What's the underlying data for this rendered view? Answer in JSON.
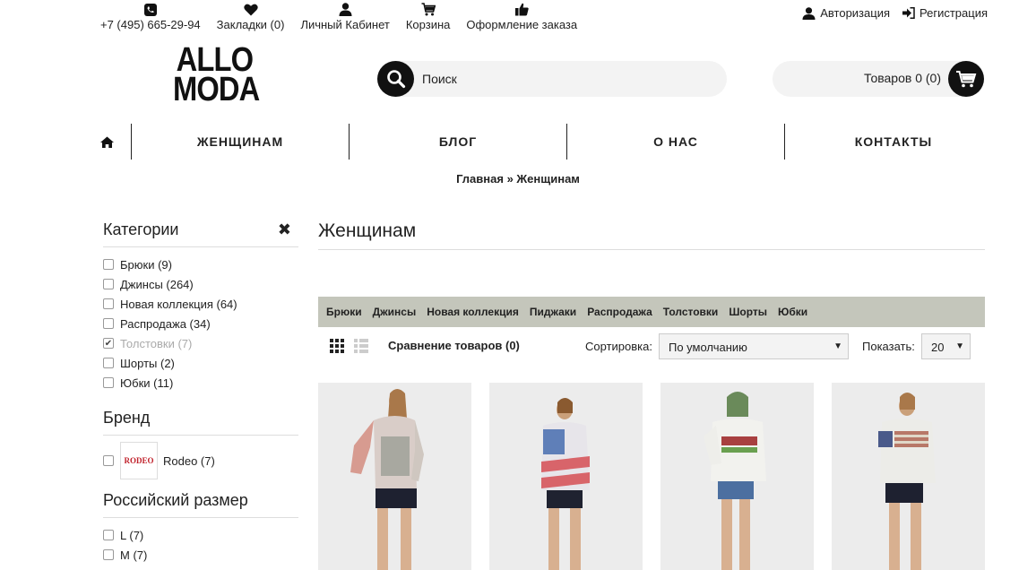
{
  "topbar": {
    "links": [
      {
        "icon": "phone-icon",
        "label": "+7 (495) 665-29-94"
      },
      {
        "icon": "heart-icon",
        "label": "Закладки (0)"
      },
      {
        "icon": "user-icon",
        "label": "Личный Кабинет"
      },
      {
        "icon": "cart-icon",
        "label": "Корзина"
      },
      {
        "icon": "thumbs-up-icon",
        "label": "Оформление заказа"
      }
    ],
    "login": "Авторизация",
    "register": "Регистрация"
  },
  "logo": {
    "line1": "ALLO",
    "line2": "MODA"
  },
  "search": {
    "placeholder": "Поиск"
  },
  "cart": {
    "label": "Товаров 0 (0)"
  },
  "nav": {
    "items": [
      "ЖЕНЩИНАМ",
      "БЛОГ",
      "О НАС",
      "КОНТАКТЫ"
    ]
  },
  "breadcrumb": {
    "home": "Главная",
    "sep": "»",
    "current": "Женщинам"
  },
  "sidebar": {
    "categories_title": "Категории",
    "categories": [
      {
        "label": "Брюки (9)",
        "checked": false
      },
      {
        "label": "Джинсы (264)",
        "checked": false
      },
      {
        "label": "Новая коллекция (64)",
        "checked": false
      },
      {
        "label": "Распродажа (34)",
        "checked": false
      },
      {
        "label": "Толстовки (7)",
        "checked": true
      },
      {
        "label": "Шорты (2)",
        "checked": false
      },
      {
        "label": "Юбки (11)",
        "checked": false
      }
    ],
    "brand_title": "Бренд",
    "brand": {
      "logo_text": "RODEO",
      "label": "Rodeo (7)"
    },
    "size_title": "Российский размер",
    "sizes": [
      {
        "label": "L (7)"
      },
      {
        "label": "M (7)"
      }
    ]
  },
  "main": {
    "title": "Женщинам",
    "subcategories": [
      "Брюки",
      "Джинсы",
      "Новая коллекция",
      "Пиджаки",
      "Распродажа",
      "Толстовки",
      "Шорты",
      "Юбки"
    ],
    "compare": "Сравнение товаров (0)",
    "sort_label": "Сортировка:",
    "sort_value": "По умолчанию",
    "show_label": "Показать:",
    "show_value": "20"
  },
  "colors": {
    "accent": "#111111",
    "catbar": "#c4c6bb"
  }
}
